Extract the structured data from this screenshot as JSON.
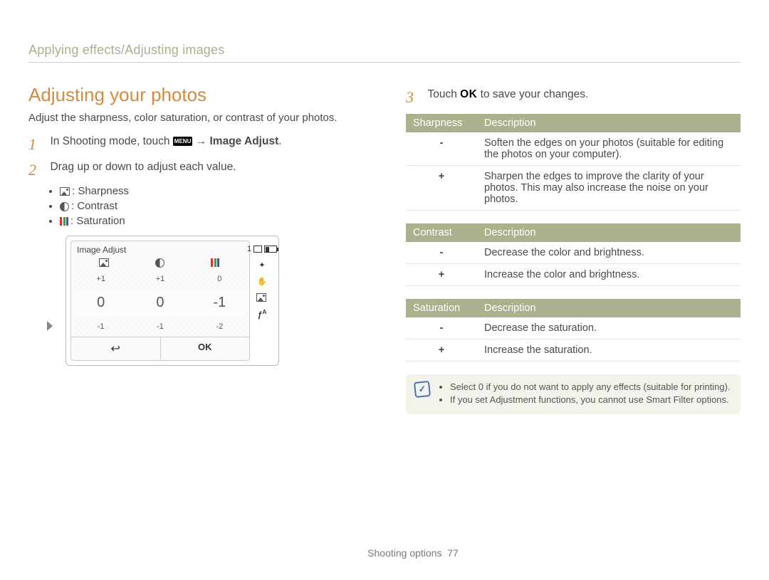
{
  "breadcrumb": "Applying effects/Adjusting images",
  "heading": "Adjusting your photos",
  "intro": "Adjust the sharpness, color saturation, or contrast of your photos.",
  "steps": {
    "s1_pre": "In Shooting mode, touch ",
    "s1_menu": "MENU",
    "s1_arrow": " → ",
    "s1_bold": "Image Adjust",
    "s1_post": ".",
    "s2": "Drag up or down to adjust each value.",
    "s3_pre": "Touch ",
    "s3_ok": "OK",
    "s3_post": " to save your changes."
  },
  "sublist": {
    "sharp": ": Sharpness",
    "contrast": ": Contrast",
    "sat": ": Saturation"
  },
  "device": {
    "title": "Image Adjust",
    "top": [
      "+1",
      "+1",
      "0"
    ],
    "mid": [
      "0",
      "0",
      "-1"
    ],
    "bot": [
      "-1",
      "-1",
      "-2"
    ],
    "back": "↩",
    "ok": "OK",
    "shots": "1"
  },
  "tables": {
    "sharpness": {
      "head1": "Sharpness",
      "head2": "Description",
      "rows": [
        {
          "k": "-",
          "v": "Soften the edges on your photos (suitable for editing the photos on your computer)."
        },
        {
          "k": "+",
          "v": "Sharpen the edges to improve the clarity of your photos. This may also increase the noise on your photos."
        }
      ]
    },
    "contrast": {
      "head1": "Contrast",
      "head2": "Description",
      "rows": [
        {
          "k": "-",
          "v": "Decrease the color and brightness."
        },
        {
          "k": "+",
          "v": "Increase the color and brightness."
        }
      ]
    },
    "saturation": {
      "head1": "Saturation",
      "head2": "Description",
      "rows": [
        {
          "k": "-",
          "v": "Decrease the saturation."
        },
        {
          "k": "+",
          "v": "Increase the saturation."
        }
      ]
    }
  },
  "note": {
    "n1": "Select 0 if you do not want to apply any effects (suitable for printing).",
    "n2": "If you set Adjustment functions, you cannot use Smart Filter options."
  },
  "footer": {
    "section": "Shooting options",
    "page": "77"
  }
}
